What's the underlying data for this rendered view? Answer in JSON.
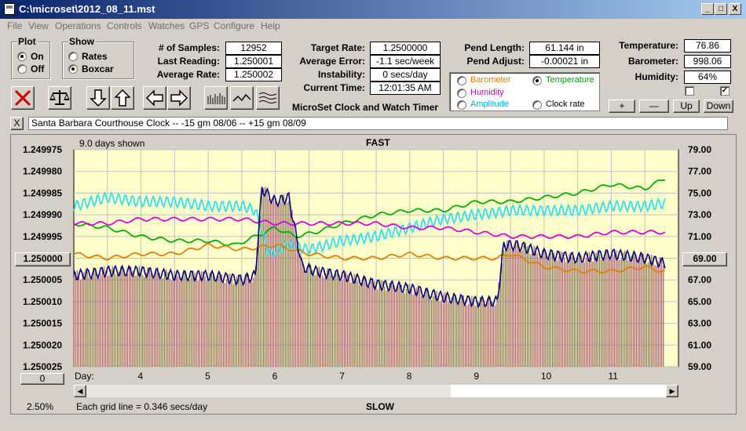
{
  "window": {
    "title": "C:\\microset\\2012_08_11.mst",
    "min": "_",
    "max": "□",
    "close": "X"
  },
  "menu": [
    "File",
    "View",
    "Operations",
    "Controls",
    "Watches",
    "GPS",
    "Configure",
    "Help"
  ],
  "plot": {
    "title": "Plot",
    "options": [
      "On",
      "Off"
    ],
    "selected": "On"
  },
  "show": {
    "title": "Show",
    "options": [
      "Rates",
      "Boxcar"
    ],
    "selected": "Boxcar"
  },
  "stats": {
    "samples_label": "# of Samples:",
    "samples": "12952",
    "last_label": "Last Reading:",
    "last": "1.250001",
    "avg_label": "Average Rate:",
    "avg": "1.250002"
  },
  "timer": {
    "target_label": "Target Rate:",
    "target": "1.2500000",
    "error_label": "Average Error:",
    "error": "-1.1 sec/week",
    "instability_label": "Instability:",
    "instability": "0 secs/day",
    "time_label": "Current Time:",
    "time": "12:01:35 AM",
    "app_name": "MicroSet Clock and Watch Timer"
  },
  "pendulum": {
    "length_label": "Pend Length:",
    "length": "61.144 in",
    "adjust_label": "Pend Adjust:",
    "adjust": "-0.00021 in"
  },
  "series_select": {
    "options": [
      {
        "label": "Barometer",
        "color": "#e67e00",
        "selected": false
      },
      {
        "label": "Temperature",
        "color": "#00a000",
        "selected": true
      },
      {
        "label": "Humidity",
        "color": "#cc00cc",
        "selected": false
      },
      {
        "label": "Clock rate",
        "color": "#000000",
        "selected": false
      },
      {
        "label": "Amplitude",
        "color": "#00b0e0",
        "selected": false
      }
    ]
  },
  "environment": {
    "temp_label": "Temperature:",
    "temp": "76.86",
    "baro_label": "Barometer:",
    "baro": "998.06",
    "humidity_label": "Humidity:",
    "humidity": "64%",
    "chk1": false,
    "chk2": true
  },
  "buttons": {
    "plus": "+",
    "minus": "—",
    "up": "Up",
    "down": "Down"
  },
  "clock_name": "Santa Barbara Courthouse Clock  --   -15 gm 08/06  --  +15 gm 08/09",
  "close_x": "X",
  "chart": {
    "days_shown": "9.0 days shown",
    "fast": "FAST",
    "slow": "SLOW",
    "left_field": "1.250000",
    "right_field": "69.00",
    "bottom_field": "0",
    "percent": "2.50%",
    "grid_note": "Each grid line = 0.346 secs/day",
    "day_label": "Day:"
  },
  "chart_data": {
    "type": "line",
    "title": "",
    "left_axis_ticks": [
      "1.249975",
      "1.249980",
      "1.249985",
      "1.249990",
      "1.249995",
      "1.250000",
      "1.250005",
      "1.250010",
      "1.250015",
      "1.250020",
      "1.250025"
    ],
    "right_axis_ticks": [
      "79.00",
      "77.00",
      "75.00",
      "73.00",
      "71.00",
      "69.00",
      "67.00",
      "65.00",
      "63.00",
      "61.00",
      "59.00"
    ],
    "left_ylim": [
      1.249975,
      1.250025
    ],
    "right_ylim": [
      59,
      79
    ],
    "x_ticks": [
      "4",
      "5",
      "6",
      "7",
      "8",
      "9",
      "10",
      "11"
    ],
    "xlim": [
      3.0,
      12.0
    ],
    "series": [
      {
        "name": "Temperature",
        "color": "#00b000",
        "x": [
          3.0,
          3.5,
          4.0,
          4.5,
          5.0,
          5.4,
          5.7,
          6.0,
          6.3,
          6.6,
          7.0,
          7.5,
          8.0,
          8.5,
          9.0,
          9.5,
          10.0,
          10.5,
          11.0,
          11.5,
          12.0
        ],
        "y": [
          1.249992,
          1.249993,
          1.249995,
          1.249996,
          1.249996,
          1.249997,
          1.249995,
          1.249993,
          1.249995,
          1.249994,
          1.249992,
          1.24999,
          1.249989,
          1.249989,
          1.249987,
          1.249987,
          1.249986,
          1.249985,
          1.249983,
          1.249984,
          1.24998
        ]
      },
      {
        "name": "Amplitude",
        "color": "#30e0f0",
        "x": [
          3.0,
          3.5,
          4.0,
          4.5,
          5.0,
          5.5,
          5.7,
          5.9,
          6.2,
          6.5,
          7.0,
          7.5,
          8.0,
          8.5,
          9.0,
          9.5,
          10.0,
          10.5,
          11.0,
          11.5,
          12.0
        ],
        "y": [
          1.249988,
          1.249986,
          1.249987,
          1.249987,
          1.249988,
          1.249988,
          1.249989,
          1.249999,
          1.249997,
          1.249998,
          1.249996,
          1.249995,
          1.249993,
          1.249991,
          1.24999,
          1.249989,
          1.249989,
          1.249989,
          1.249988,
          1.249988,
          1.249987
        ]
      },
      {
        "name": "Humidity",
        "color": "#dd00dd",
        "x": [
          3.0,
          3.5,
          4.0,
          4.5,
          5.0,
          5.5,
          6.0,
          6.5,
          7.0,
          7.5,
          8.0,
          8.5,
          9.0,
          9.5,
          10.0,
          10.5,
          11.0,
          11.5,
          12.0
        ],
        "y": [
          1.249992,
          1.249992,
          1.249991,
          1.249991,
          1.249991,
          1.249991,
          1.249992,
          1.249992,
          1.249992,
          1.249992,
          1.249993,
          1.249993,
          1.249994,
          1.249995,
          1.249995,
          1.249995,
          1.249994,
          1.249994,
          1.249994
        ]
      },
      {
        "name": "Barometer",
        "color": "#e67e00",
        "x": [
          3.0,
          3.5,
          4.0,
          4.5,
          5.0,
          5.5,
          6.0,
          6.5,
          7.0,
          7.5,
          8.0,
          8.5,
          9.0,
          9.3,
          9.5,
          10.0,
          10.5,
          11.0,
          11.5,
          12.0
        ],
        "y": [
          1.249999,
          1.25,
          1.249999,
          1.249999,
          1.249997,
          1.249998,
          1.249997,
          1.249999,
          1.25,
          1.25,
          1.249999,
          1.25,
          1.25,
          1.25,
          1.249999,
          1.250002,
          1.250003,
          1.250003,
          1.250002,
          1.250004
        ]
      },
      {
        "name": "Clock rate",
        "color": "#000080",
        "fill": "#9b6565",
        "x": [
          3.0,
          3.5,
          4.0,
          4.5,
          5.0,
          5.5,
          5.7,
          5.8,
          6.0,
          6.2,
          6.4,
          6.6,
          7.0,
          7.5,
          8.0,
          8.5,
          9.0,
          9.3,
          9.4,
          9.6,
          10.0,
          10.5,
          11.0,
          11.5,
          12.0
        ],
        "y": [
          1.250004,
          1.250003,
          1.250003,
          1.250004,
          1.250004,
          1.250005,
          1.250004,
          1.249984,
          1.249987,
          1.249986,
          1.250002,
          1.250003,
          1.250004,
          1.250006,
          1.250007,
          1.250009,
          1.25001,
          1.25001,
          1.249997,
          1.249997,
          1.249999,
          1.25,
          1.249999,
          1.25,
          1.250002
        ]
      }
    ]
  }
}
